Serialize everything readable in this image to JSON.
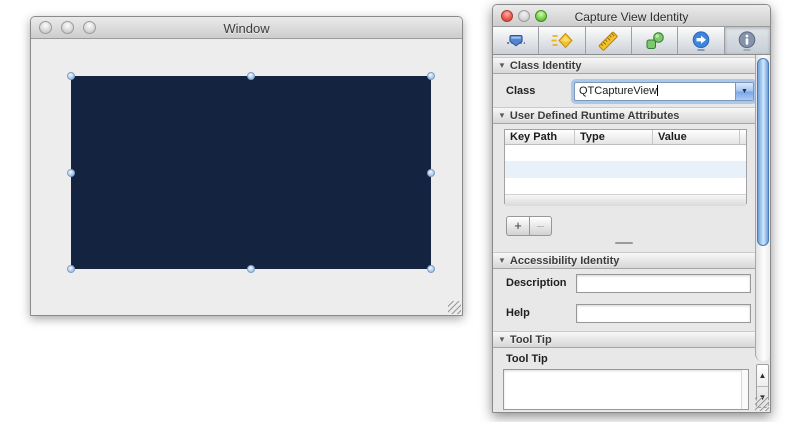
{
  "colors": {
    "capture_view_fill": "#142440",
    "selection_handle": "#b5cdea",
    "scrollbar_thumb": "#6d9fda",
    "focus_ring": "#7daae6"
  },
  "glyphs": {
    "disclosure": "▼",
    "dropdown_arrow": "▼",
    "scroll_up": "▲",
    "scroll_down": "▼",
    "add": "+",
    "remove": "–"
  },
  "design_window": {
    "title": "Window"
  },
  "inspector": {
    "title": "Capture View Identity",
    "toolbar_icons": [
      "attributes-inspector-icon",
      "effects-inspector-icon",
      "size-inspector-icon",
      "bindings-inspector-icon",
      "connections-inspector-icon",
      "identity-inspector-icon"
    ],
    "selected_tab": "identity",
    "class_identity": {
      "title": "Class Identity",
      "class_label": "Class",
      "class_value": "QTCaptureView"
    },
    "runtime_attributes": {
      "title": "User Defined Runtime Attributes",
      "columns": [
        "Key Path",
        "Type",
        "Value"
      ],
      "rows": []
    },
    "accessibility": {
      "title": "Accessibility Identity",
      "description_label": "Description",
      "description_value": "",
      "help_label": "Help",
      "help_value": ""
    },
    "tool_tip": {
      "title": "Tool Tip",
      "label": "Tool Tip",
      "value": ""
    }
  }
}
